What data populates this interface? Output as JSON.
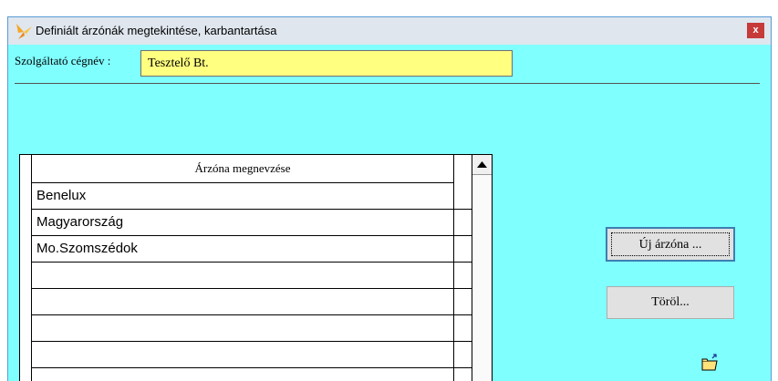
{
  "window": {
    "title": "Definiált árzónák megtekintése, karbantartása",
    "close_label": "x"
  },
  "provider": {
    "label": "Szolgáltató cégnév :",
    "value": "Tesztelő Bt."
  },
  "grid": {
    "header": "Árzóna megnevzése",
    "rows": [
      "Benelux",
      "Magyarország",
      "Mo.Szomszédok",
      "",
      "",
      "",
      ""
    ]
  },
  "buttons": {
    "new_zone": "Új árzóna ...",
    "delete": "Töröl..."
  },
  "icons": {
    "app": "butterfly-icon",
    "open": "open-folder-icon",
    "scroll_up": "scroll-up-arrow-icon"
  },
  "colors": {
    "window_bg": "#80ffff",
    "field_bg": "#ffff80",
    "close_bg": "#c63a3a",
    "button_focus": "#3c7fb1"
  }
}
